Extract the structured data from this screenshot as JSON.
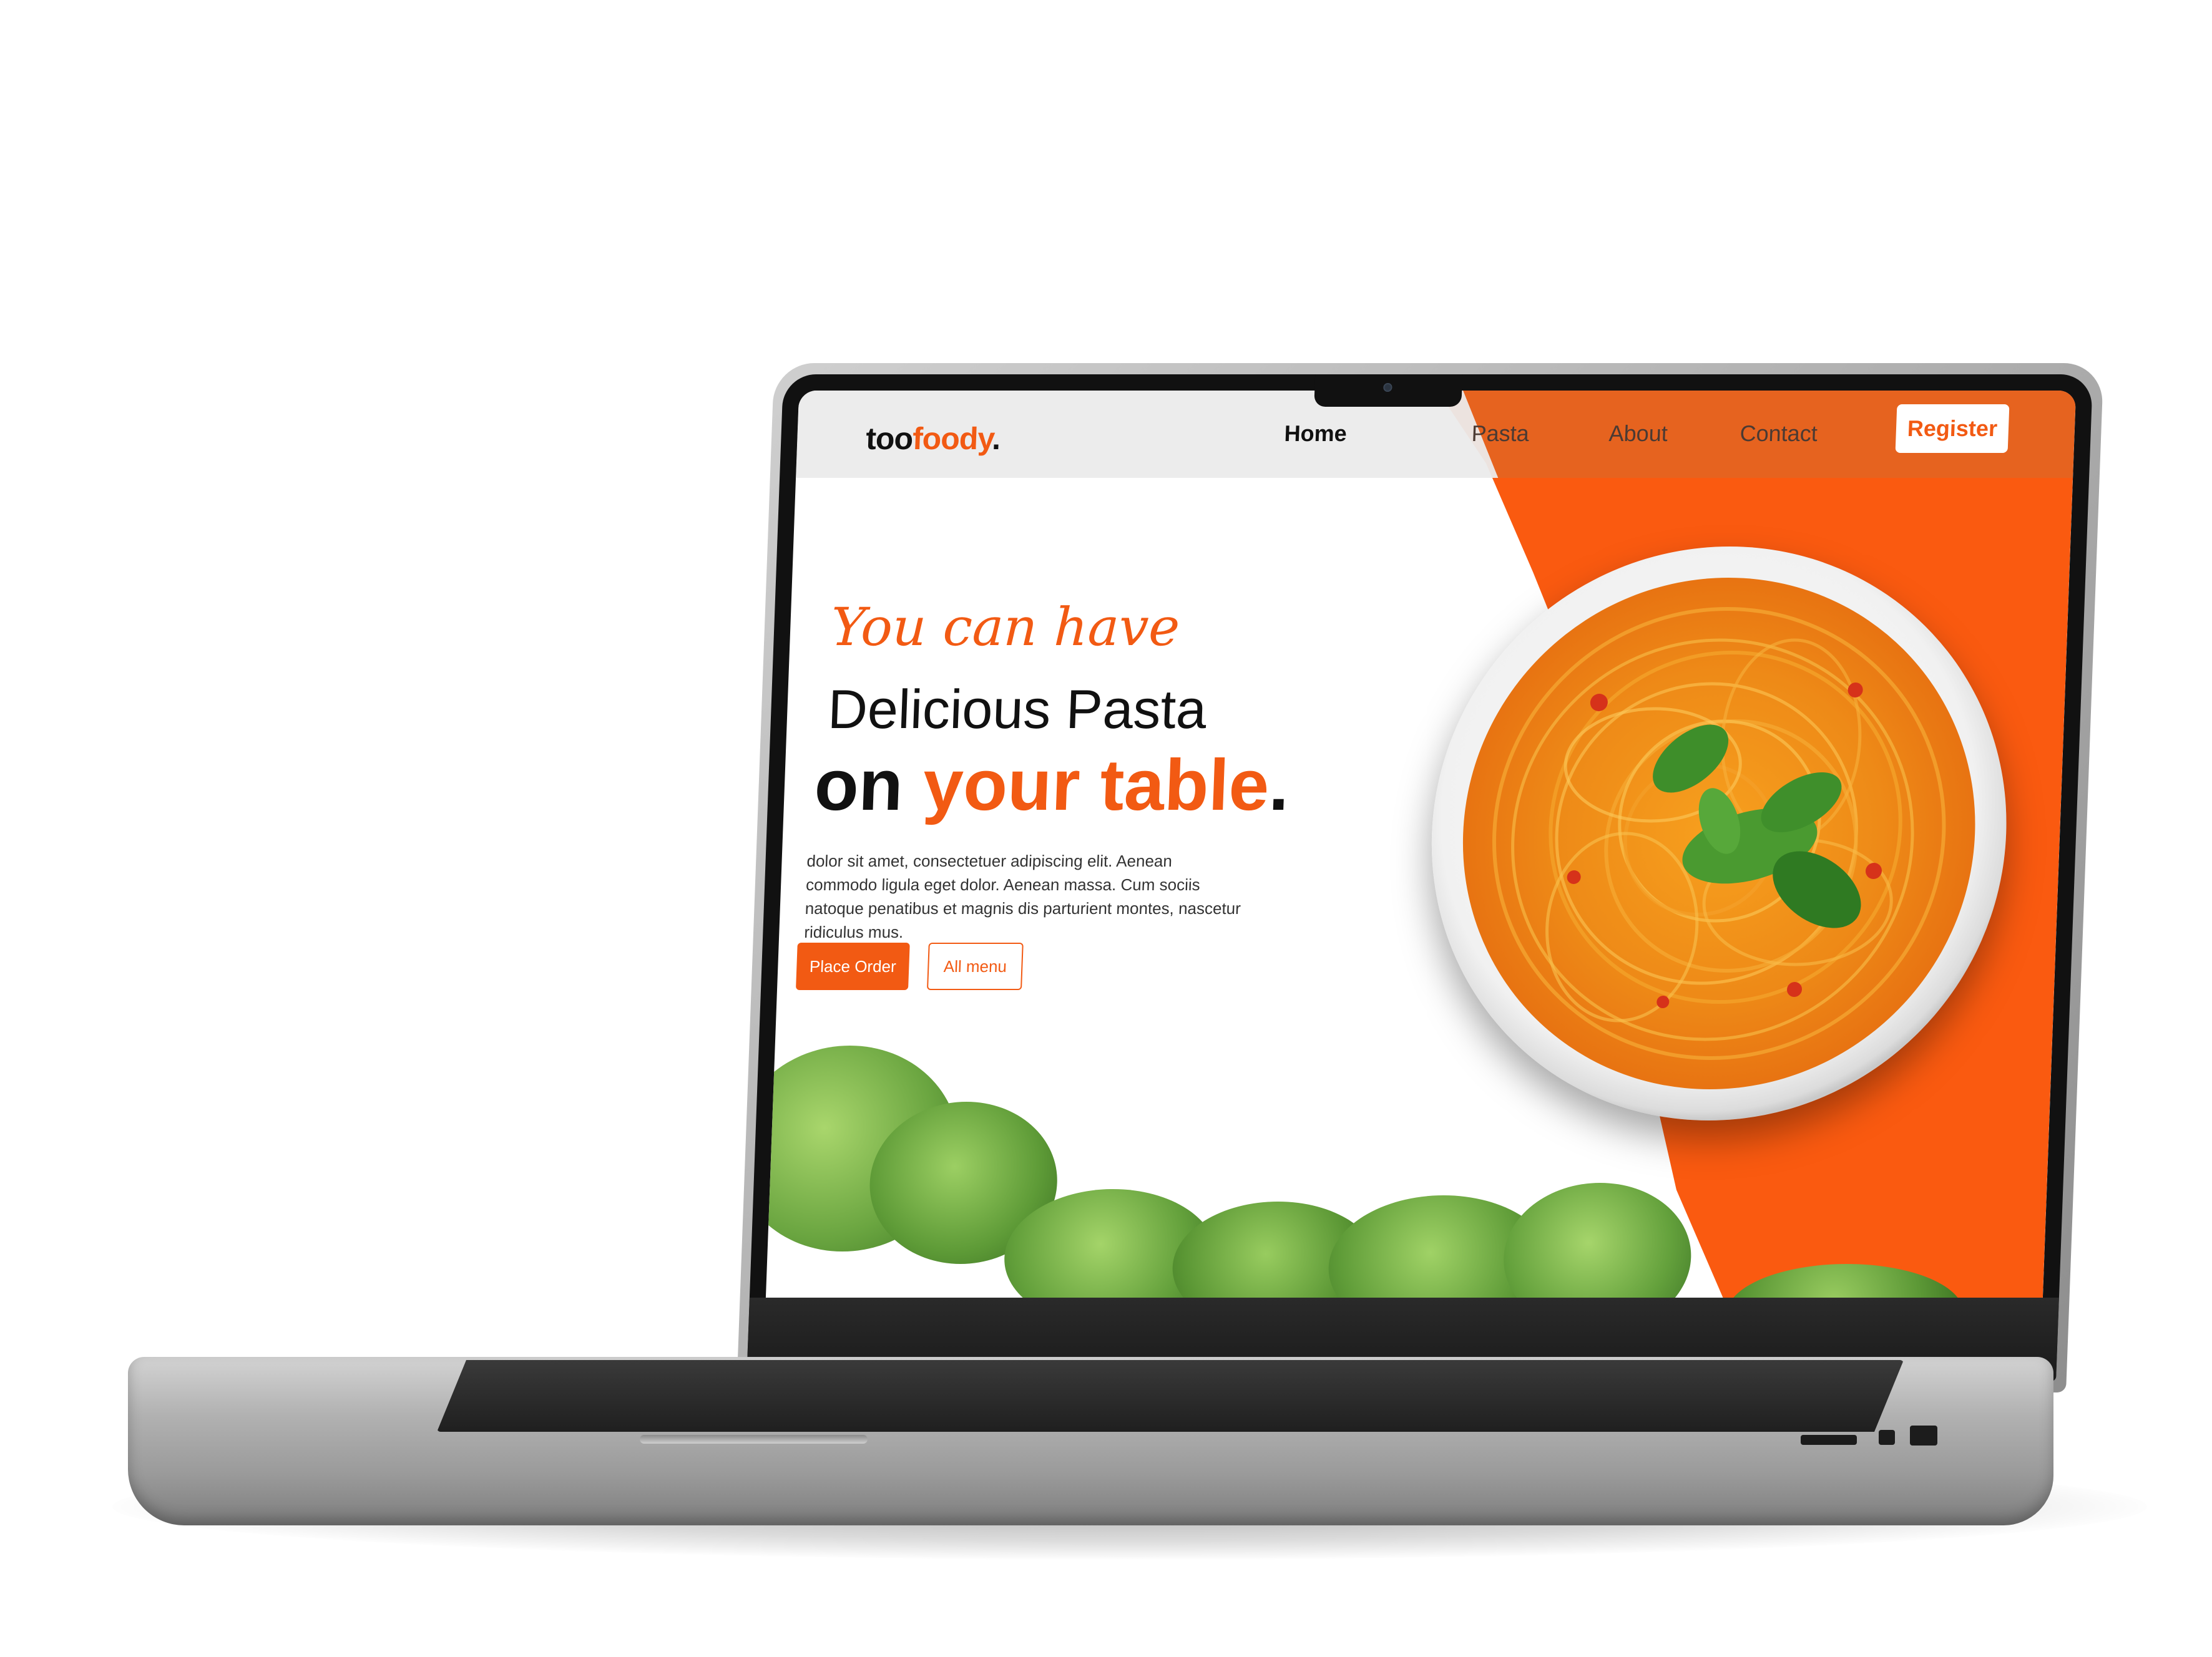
{
  "brand": {
    "logo_prefix": "too",
    "logo_accent": "foody",
    "logo_suffix": "."
  },
  "nav": {
    "items": [
      "Home",
      "Pasta",
      "About",
      "Contact"
    ],
    "register_label": "Register"
  },
  "hero": {
    "script_line": "You can have",
    "line2": "Delicious Pasta",
    "line3_prefix": "on ",
    "line3_accent": "your table",
    "line3_suffix": ".",
    "description": "dolor sit amet, consectetuer adipiscing elit. Aenean commodo ligula eget dolor. Aenean massa. Cum sociis natoque penatibus et magnis dis parturient montes, nascetur ridiculus mus.",
    "primary_button": "Place Order",
    "secondary_button": "All menu"
  },
  "colors": {
    "accent": "#f25a13",
    "orange_bg": "#fa5a10",
    "nav_light": "#ebebeb",
    "text_dark": "#111111",
    "lettuce_green": "#6aa540"
  },
  "icons": [
    "camera-icon",
    "pasta-bowl-image",
    "basil-leaf-icon",
    "lettuce-image"
  ]
}
